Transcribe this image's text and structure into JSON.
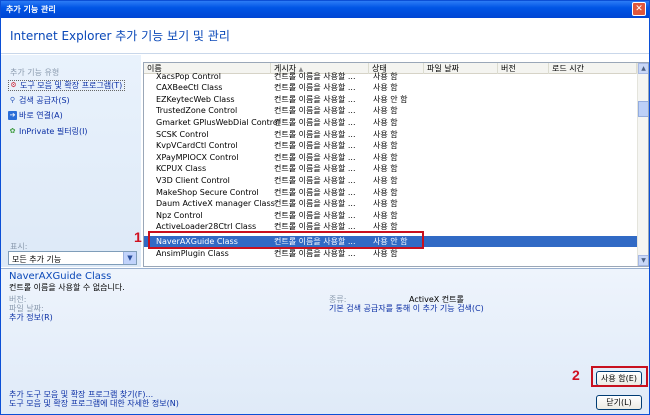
{
  "window": {
    "title": "추가 기능 관리",
    "close_icon": "close-icon"
  },
  "header": {
    "heading": "Internet Explorer 추가 기능 보기 및 관리"
  },
  "sidebar": {
    "types_label": "추가 기능 유형",
    "items": [
      {
        "label": "도구 모음 및 확장 프로그램(T)",
        "icon": "gear-icon"
      },
      {
        "label": "검색 공급자(S)",
        "icon": "search-icon"
      },
      {
        "label": "바로 연결(A)",
        "icon": "accelerator-icon"
      },
      {
        "label": "InPrivate 필터링(I)",
        "icon": "inprivate-icon"
      }
    ],
    "show_label": "표시:",
    "show_value": "모든 추가 기능"
  },
  "list": {
    "columns": [
      "이름",
      "게시자",
      "상태",
      "파일 날짜",
      "버전",
      "로드 시간"
    ],
    "sort_icon": "sort-ascending-icon",
    "rows": [
      {
        "name": "XacsPop Control",
        "publisher": "컨트롤 이름을 사용할 ...",
        "status": "사용 함"
      },
      {
        "name": "CAXBeeCtl Class",
        "publisher": "컨트롤 이름을 사용할 ...",
        "status": "사용 함"
      },
      {
        "name": "EZKeytecWeb Class",
        "publisher": "컨트롤 이름을 사용할 ...",
        "status": "사용 안 함"
      },
      {
        "name": "TrustedZone Control",
        "publisher": "컨트롤 이름을 사용할 ...",
        "status": "사용 함"
      },
      {
        "name": "Gmarket GPlusWebDial Control",
        "publisher": "컨트롤 이름을 사용할 ...",
        "status": "사용 함"
      },
      {
        "name": "SCSK Control",
        "publisher": "컨트롤 이름을 사용할 ...",
        "status": "사용 함"
      },
      {
        "name": "KvpVCardCtl Control",
        "publisher": "컨트롤 이름을 사용할 ...",
        "status": "사용 함"
      },
      {
        "name": "XPayMPIOCX Control",
        "publisher": "컨트롤 이름을 사용할 ...",
        "status": "사용 함"
      },
      {
        "name": "KCPUX Class",
        "publisher": "컨트롤 이름을 사용할 ...",
        "status": "사용 함"
      },
      {
        "name": "V3D Client Control",
        "publisher": "컨트롤 이름을 사용할 ...",
        "status": "사용 함"
      },
      {
        "name": "MakeShop Secure Control",
        "publisher": "컨트롤 이름을 사용할 ...",
        "status": "사용 함"
      },
      {
        "name": "Daum ActiveX manager Class",
        "publisher": "컨트롤 이름을 사용할 ...",
        "status": "사용 함"
      },
      {
        "name": "Npz Control",
        "publisher": "컨트롤 이름을 사용할 ...",
        "status": "사용 함"
      },
      {
        "name": "ActiveLoader28Ctrl Class",
        "publisher": "컨트롤 이름을 사용할 ...",
        "status": "사용 함"
      },
      {
        "name": "NaverAXGuide Class",
        "publisher": "컨트롤 이름을 사용할 ...",
        "status": "사용 안 함"
      },
      {
        "name": "AnsimPlugin Class",
        "publisher": "컨트롤 이름을 사용할 ...",
        "status": "사용 함"
      }
    ]
  },
  "detail": {
    "name": "NaverAXGuide Class",
    "desc": "컨트롤 이름을 사용할 수 없습니다.",
    "version_label": "버전:",
    "file_date_label": "파일 날짜:",
    "more_info": "추가 정보(R)",
    "type_label": "종류:",
    "type_value": "ActiveX 컨트롤",
    "search_link": "기본 검색 공급자를 통해 이 추가 기능 검색(C)",
    "enable_button": "사용 함(E)",
    "find_more": "추가 도구 모음 및 확장 프로그램 찾기(F)...",
    "learn_more": "도구 모음 및 확장 프로그램에 대한 자세한 정보(N)",
    "close_button": "닫기(L)"
  },
  "annotations": {
    "marker1": "1",
    "marker2": "2",
    "color": "#c8101e"
  }
}
